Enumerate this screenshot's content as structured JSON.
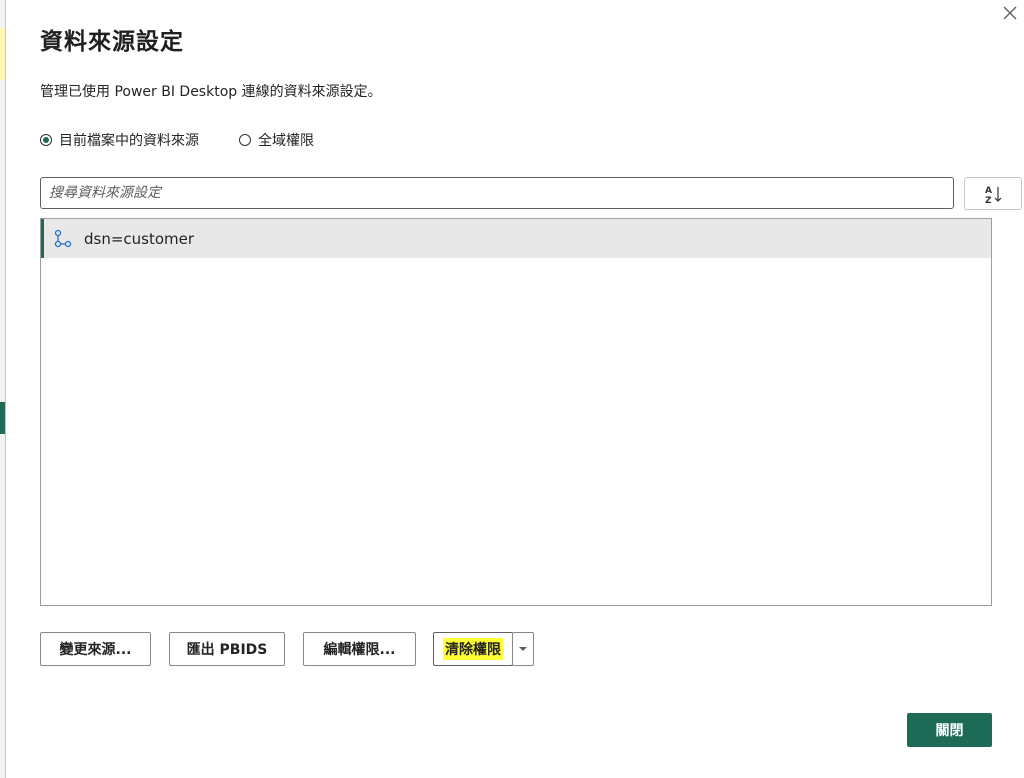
{
  "dialog": {
    "title": "資料來源設定",
    "subtitle": "管理已使用 Power BI Desktop 連線的資料來源設定。",
    "close_icon": "close-icon"
  },
  "scope": {
    "options": [
      {
        "label": "目前檔案中的資料來源",
        "selected": true
      },
      {
        "label": "全域權限",
        "selected": false
      }
    ]
  },
  "search": {
    "placeholder": "搜尋資料來源設定",
    "value": ""
  },
  "sort": {
    "icon": "sort-az-icon"
  },
  "sources": [
    {
      "label": "dsn=customer",
      "icon": "odbc-connection-icon",
      "selected": true
    }
  ],
  "actions": {
    "change_source": "變更來源...",
    "export_pbids": "匯出 PBIDS",
    "edit_permissions": "編輯權限...",
    "clear_permissions": "清除權限"
  },
  "footer": {
    "close_label": "關閉"
  },
  "colors": {
    "accent": "#1d6b57",
    "highlight": "#ffff33",
    "selection_bg": "#e8e8e8"
  }
}
